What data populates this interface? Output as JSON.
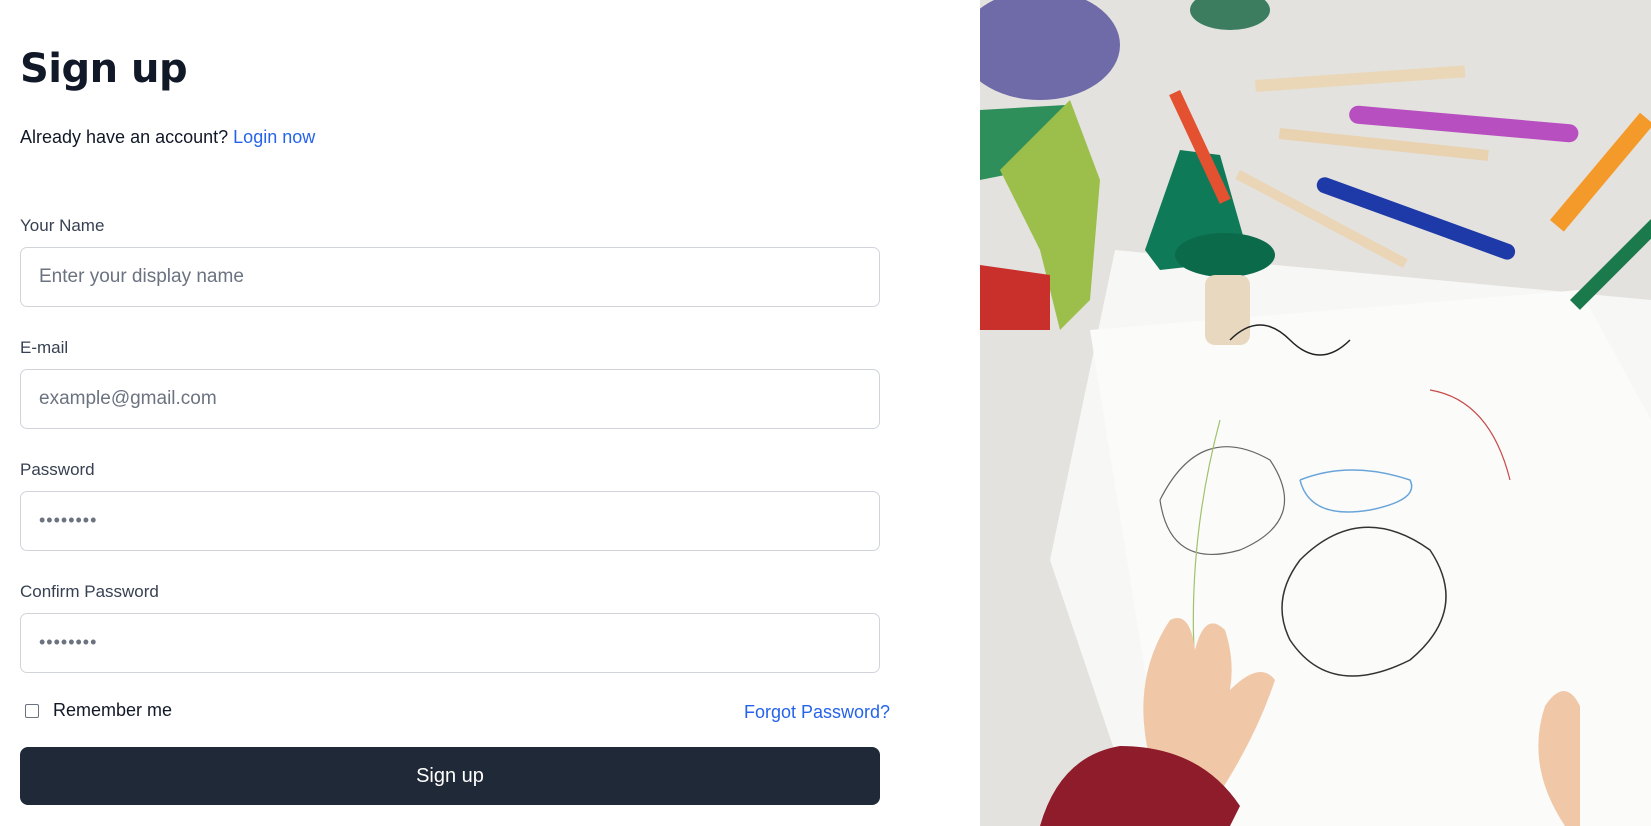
{
  "page": {
    "title": "Sign up"
  },
  "subtitle": {
    "text": "Already have an account?",
    "link": "Login now"
  },
  "form": {
    "name": {
      "label": "Your Name",
      "placeholder": "Enter your display name"
    },
    "email": {
      "label": "E-mail",
      "placeholder": "example@gmail.com"
    },
    "password": {
      "label": "Password",
      "placeholder": "••••••••"
    },
    "confirm": {
      "label": "Confirm Password",
      "placeholder": "••••••••"
    },
    "remember": "Remember me",
    "forgot": "Forgot Password?",
    "submit": "Sign up"
  },
  "colors": {
    "accent": "#2563eb",
    "button": "#1f2937",
    "text": "#111827"
  }
}
